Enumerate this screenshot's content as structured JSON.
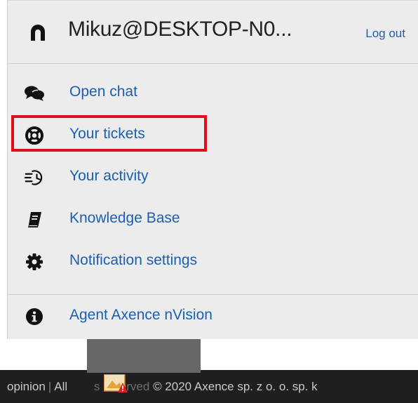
{
  "header": {
    "username": "Mikuz@DESKTOP-N0...",
    "logout_label": "Log out"
  },
  "menu": {
    "items": [
      {
        "label": "Open chat",
        "icon": "chat-bubbles-icon"
      },
      {
        "label": "Your tickets",
        "icon": "lifebuoy-icon"
      },
      {
        "label": "Your activity",
        "icon": "activity-clock-icon"
      },
      {
        "label": "Knowledge Base",
        "icon": "book-icon"
      },
      {
        "label": "Notification settings",
        "icon": "gear-icon"
      },
      {
        "label": "Agent Axence nVision",
        "icon": "info-icon"
      }
    ]
  },
  "footer": {
    "opinion": "opinion",
    "rights_prefix": "All",
    "rights_suffix": "s reserved",
    "copyright": "© 2020 Axence sp. z o. o. sp. k"
  },
  "colors": {
    "link": "#1a5fb0",
    "menu_bg": "#ececec",
    "highlight": "#e30d17",
    "footer_bg": "#1f1f22"
  }
}
